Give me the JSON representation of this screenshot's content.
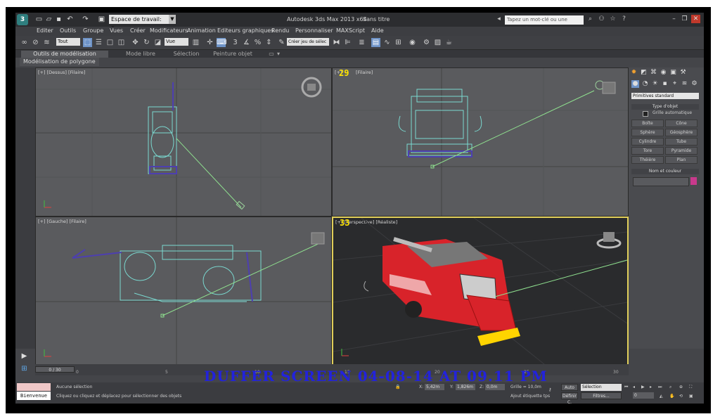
{
  "titlebar": {
    "logo": "3",
    "workspace": "Espace de travail: Par",
    "app_title": "Autodesk 3ds Max  2013 x64",
    "document": "Sans titre",
    "help_placeholder": "Tapez un mot-clé ou une expression"
  },
  "menu": [
    "Editer",
    "Outils",
    "Groupe",
    "Vues",
    "Créer",
    "Modificateurs",
    "Animation",
    "Editeurs graphiques",
    "Rendu",
    "Personnaliser",
    "MAXScript",
    "Aide"
  ],
  "toolbar": {
    "filter": "Tout",
    "refcoord": "Vue",
    "selset": "Créer jeu de sélec"
  },
  "ribbon": {
    "tabs": [
      "Outils de modélisation graphite",
      "Mode libre",
      "Sélection",
      "Peinture objet"
    ],
    "sub": "Modélisation de polygone"
  },
  "viewports": {
    "top": {
      "label": "[+] [Dessus] [Filaire]"
    },
    "front": {
      "label": "[Filaire]",
      "prefix": "[+]",
      "overlay": "29"
    },
    "left": {
      "label": "[+] [Gauche] [Filaire]"
    },
    "persp": {
      "label": "[+] [Perspective] [Réaliste]",
      "overlay": "33"
    }
  },
  "command_panel": {
    "category": "Primitives standard",
    "object_type_title": "Type d'objet",
    "autogrid": "Grille automatique",
    "buttons": [
      "Boîte",
      "Cône",
      "Sphère",
      "Géosphère",
      "Cylindre",
      "Tube",
      "Tore",
      "Pyramide",
      "Théière",
      "Plan"
    ],
    "name_color_title": "Nom et couleur",
    "swatch_color": "#c8398c"
  },
  "timeline": {
    "frame": "0 / 30",
    "ticks": [
      "0",
      "5",
      "10",
      "15",
      "20",
      "25",
      "30"
    ]
  },
  "status": {
    "welcome": "Bienvenue",
    "selection": "Aucune sélection",
    "prompt": "Cliquez ou cliquez et déplacez pour sélectionner des objets",
    "x": "5,42m",
    "y": "1,826m",
    "z": "0,0m",
    "grid": "Grille = 10,0m",
    "addtag": "Ajout étiquette tps",
    "auto": "Auto",
    "set_key": "Définir C.",
    "key_mode": "Sélection",
    "filters": "Filtres...",
    "frame_field": "0"
  },
  "watermark": "DUFFER SCREEN 04-08-14 AT 09.11 PM"
}
